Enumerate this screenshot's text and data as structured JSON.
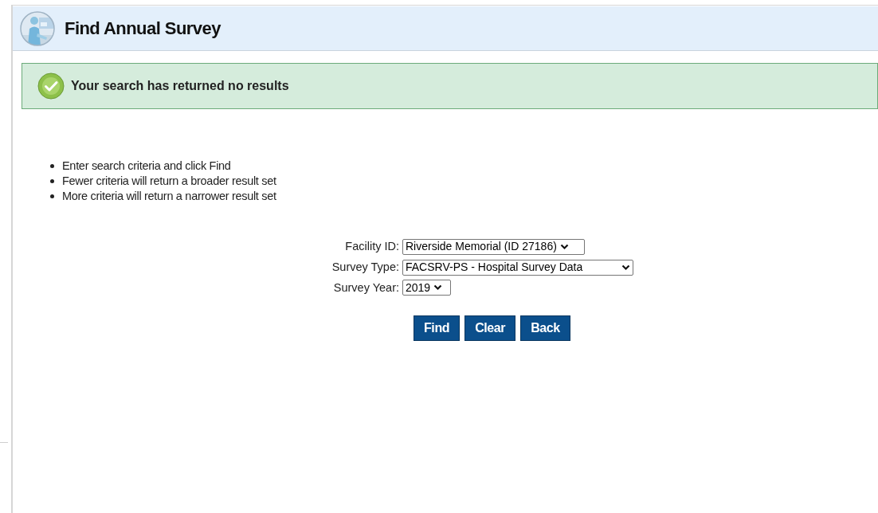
{
  "header": {
    "title": "Find Annual Survey"
  },
  "message": {
    "kind": "success",
    "text": "Your search has returned no results"
  },
  "instructions": [
    "Enter search criteria and click Find",
    "Fewer criteria will return a broader result set",
    "More criteria will return a narrower result set"
  ],
  "fields": [
    {
      "label": "Facility ID:",
      "value": "Riverside Memorial (ID 27186)"
    },
    {
      "label": "Survey Type:",
      "value": "FACSRV-PS - Hospital Survey Data"
    },
    {
      "label": "Survey Year:",
      "value": "2019"
    }
  ],
  "buttons": [
    "Find",
    "Clear",
    "Back"
  ]
}
